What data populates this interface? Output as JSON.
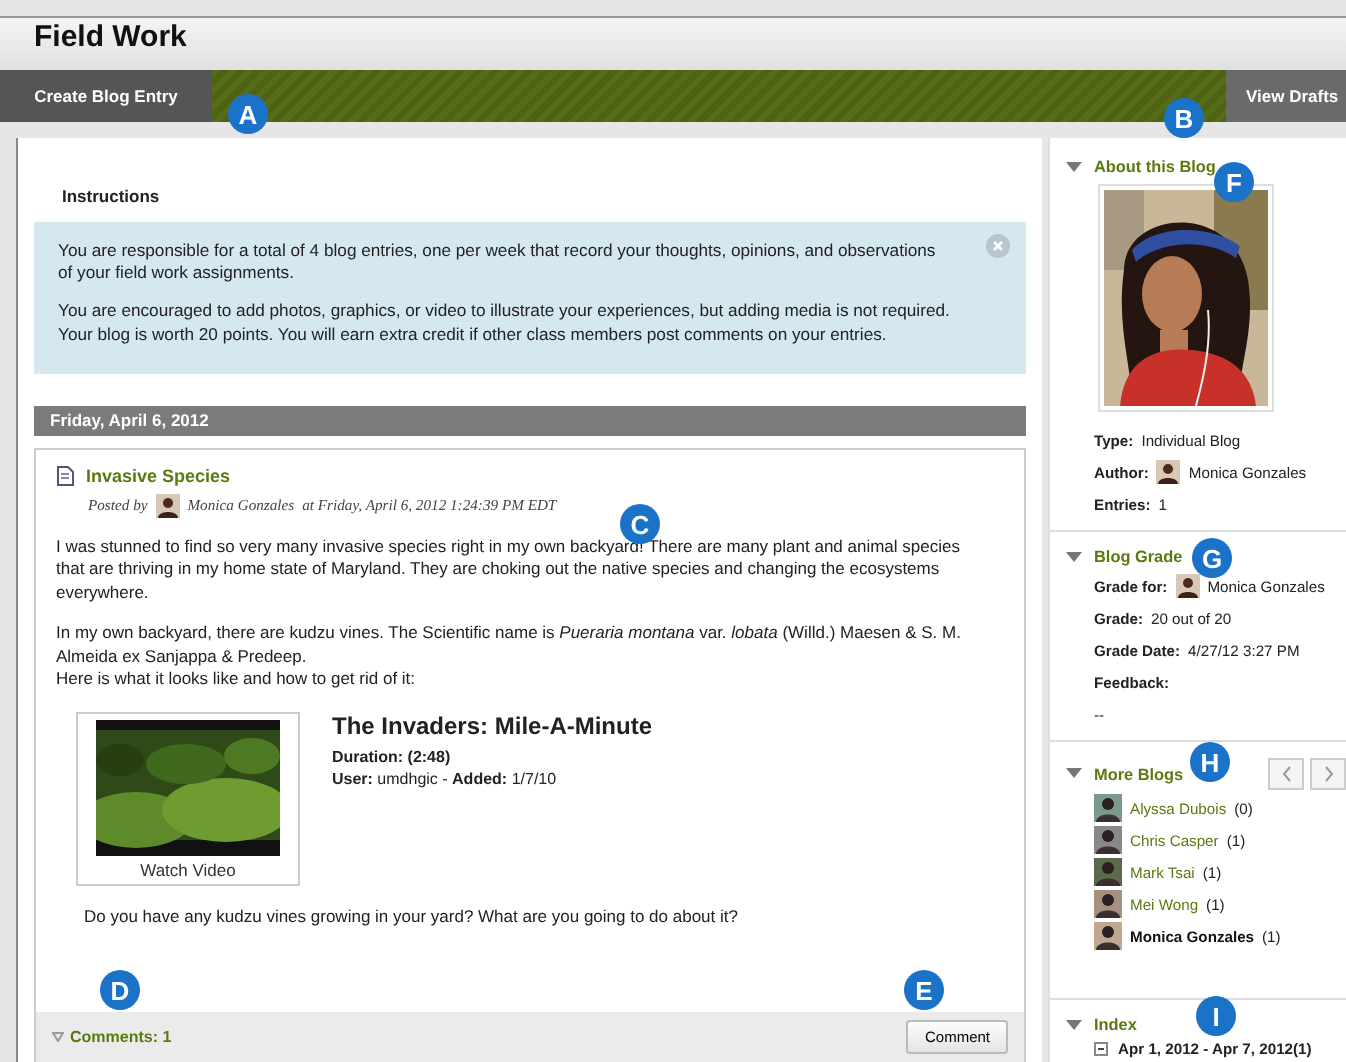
{
  "page_title": "Field Work",
  "action_bar": {
    "buttons": [
      {
        "label": "Create Blog Entry"
      },
      {
        "label": "View Drafts"
      }
    ]
  },
  "instructions": {
    "tab": "Instructions",
    "paragraphs": [
      "You are responsible for a total of 4 blog entries, one per week that record your thoughts, opinions, and observations of your field work assignments.",
      "You are encouraged to add photos, graphics, or video to illustrate your experiences, but adding media is not required. Your blog is worth 20 points. You will earn extra credit if other class members post comments on your entries."
    ]
  },
  "date_header": "Friday, April 6, 2012",
  "entry": {
    "title": "Invasive Species",
    "posted_by": "Posted by",
    "author": "Monica Gonzales",
    "timestamp": "at Friday, April 6, 2012 1:24:39 PM EDT",
    "paragraphs": [
      [
        "I was stunned to find so very many invasive species right in my own backyard! There are many plant and animal species that are thriving in my home state of Maryland. They are choking out the native species and changing the ecosystems everywhere."
      ],
      [
        "In my own backyard, there are kudzu vines. The Scientific name is *Pueraria montana* var. *lobata* (Willd.) Maesen & S. M. Almeida ex Sanjappa & Predeep.",
        "Here is what it looks like and how to get rid of it:"
      ]
    ],
    "video": {
      "caption": "Watch Video",
      "title": "The Invaders: Mile-A-Minute",
      "details": [
        "**Duration: (2:48)**",
        "**User:** umdhgic - **Added:** 1/7/10"
      ]
    },
    "question": "Do you have any kudzu vines growing in your yard? What are you going to do about it?",
    "comments": "Comments: 1",
    "comment_button": "Comment"
  },
  "sidebar": [
    {
      "kind": "about",
      "title": "About this Blog",
      "expanded": true,
      "fields": [
        {
          "label": "Type:",
          "value": "Individual Blog"
        },
        {
          "label": "Author:",
          "value": "Monica Gonzales",
          "kind": "person"
        },
        {
          "label": "Entries:",
          "value": "1"
        }
      ]
    },
    {
      "kind": "grade",
      "title": "Blog Grade",
      "expanded": true,
      "fields": [
        {
          "label": "Grade for:",
          "value": "Monica Gonzales",
          "kind": "person"
        },
        {
          "label": "Grade:",
          "value": "20 out of 20"
        },
        {
          "label": "Grade Date:",
          "value": "4/27/12 3:27 PM"
        },
        {
          "label": "Feedback:"
        },
        {
          "value": "--"
        }
      ]
    },
    {
      "kind": "blogs",
      "title": "More Blogs",
      "expanded": true,
      "blogs": [
        {
          "name": "Alyssa Dubois",
          "count": "(0)",
          "selected": false
        },
        {
          "name": "Chris Casper",
          "count": "(1)",
          "selected": false
        },
        {
          "name": "Mark Tsai",
          "count": "(1)",
          "selected": false
        },
        {
          "name": "Mei Wong",
          "count": "(1)",
          "selected": false
        },
        {
          "name": "Monica Gonzales",
          "count": "(1)",
          "selected": true
        }
      ]
    },
    {
      "kind": "index",
      "title": "Index",
      "expanded": true,
      "items": [
        "Apr 1, 2012 - Apr 7, 2012(1)"
      ]
    }
  ],
  "callouts": [
    "A",
    "B",
    "C",
    "D",
    "E",
    "F",
    "G",
    "H",
    "I"
  ]
}
